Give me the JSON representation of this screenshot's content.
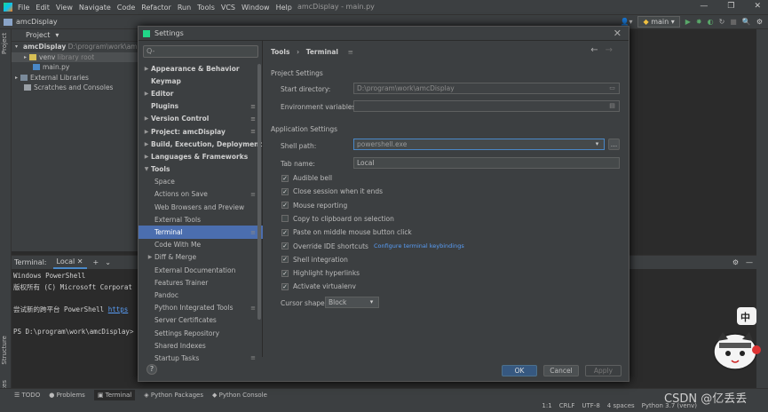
{
  "menubar": {
    "items": [
      "File",
      "Edit",
      "View",
      "Navigate",
      "Code",
      "Refactor",
      "Run",
      "Tools",
      "VCS",
      "Window",
      "Help"
    ],
    "window_title": "amcDisplay - main.py"
  },
  "navbar": {
    "project": "amcDisplay",
    "run_config": "main"
  },
  "project_panel": {
    "title": "Project",
    "tree": [
      {
        "name": "amcDisplay",
        "hint": "D:\\program\\work\\amcD"
      },
      {
        "name": "venv",
        "hint": "library root"
      },
      {
        "name": "main.py",
        "hint": ""
      },
      {
        "name": "External Libraries",
        "hint": ""
      },
      {
        "name": "Scratches and Consoles",
        "hint": ""
      }
    ]
  },
  "side_tabs": {
    "project": "Project",
    "structure": "Structure",
    "favorites": "Favorites"
  },
  "terminal": {
    "label": "Terminal:",
    "tab": "Local",
    "lines": [
      "Windows PowerShell",
      "版权所有 (C) Microsoft Corporat",
      "",
      "尝试新的跨平台 PowerShell",
      "",
      "PS D:\\program\\work\\amcDisplay> "
    ],
    "link": "https"
  },
  "bottom_tabs": [
    "TODO",
    "Problems",
    "Terminal",
    "Python Packages",
    "Python Console"
  ],
  "status_bar": {
    "pos": "1:1",
    "eol": "CRLF",
    "enc": "UTF-8",
    "indent": "4 spaces",
    "interp": "Python 3.7 (venv)"
  },
  "dialog": {
    "title": "Settings",
    "search_placeholder": "Q-",
    "nav": [
      {
        "label": "Appearance & Behavior",
        "level": 0,
        "bold": true,
        "arrow": "right",
        "gear": false
      },
      {
        "label": "Keymap",
        "level": 0,
        "bold": true,
        "arrow": "",
        "gear": false
      },
      {
        "label": "Editor",
        "level": 0,
        "bold": true,
        "arrow": "right",
        "gear": false
      },
      {
        "label": "Plugins",
        "level": 0,
        "bold": true,
        "arrow": "",
        "gear": true
      },
      {
        "label": "Version Control",
        "level": 0,
        "bold": true,
        "arrow": "right",
        "gear": true
      },
      {
        "label": "Project: amcDisplay",
        "level": 0,
        "bold": true,
        "arrow": "right",
        "gear": true
      },
      {
        "label": "Build, Execution, Deployment",
        "level": 0,
        "bold": true,
        "arrow": "right",
        "gear": false
      },
      {
        "label": "Languages & Frameworks",
        "level": 0,
        "bold": true,
        "arrow": "right",
        "gear": false
      },
      {
        "label": "Tools",
        "level": 0,
        "bold": true,
        "arrow": "down",
        "gear": false
      },
      {
        "label": "Space",
        "level": 1,
        "bold": false,
        "arrow": "",
        "gear": false
      },
      {
        "label": "Actions on Save",
        "level": 1,
        "bold": false,
        "arrow": "",
        "gear": true
      },
      {
        "label": "Web Browsers and Preview",
        "level": 1,
        "bold": false,
        "arrow": "",
        "gear": false
      },
      {
        "label": "External Tools",
        "level": 1,
        "bold": false,
        "arrow": "",
        "gear": false
      },
      {
        "label": "Terminal",
        "level": 1,
        "bold": false,
        "arrow": "",
        "gear": true,
        "selected": true
      },
      {
        "label": "Code With Me",
        "level": 1,
        "bold": false,
        "arrow": "",
        "gear": false
      },
      {
        "label": "Diff & Merge",
        "level": 1,
        "bold": false,
        "arrow": "right",
        "gear": false
      },
      {
        "label": "External Documentation",
        "level": 1,
        "bold": false,
        "arrow": "",
        "gear": false
      },
      {
        "label": "Features Trainer",
        "level": 1,
        "bold": false,
        "arrow": "",
        "gear": false
      },
      {
        "label": "Pandoc",
        "level": 1,
        "bold": false,
        "arrow": "",
        "gear": false
      },
      {
        "label": "Python Integrated Tools",
        "level": 1,
        "bold": false,
        "arrow": "",
        "gear": true
      },
      {
        "label": "Server Certificates",
        "level": 1,
        "bold": false,
        "arrow": "",
        "gear": false
      },
      {
        "label": "Settings Repository",
        "level": 1,
        "bold": false,
        "arrow": "",
        "gear": false
      },
      {
        "label": "Shared Indexes",
        "level": 1,
        "bold": false,
        "arrow": "",
        "gear": false
      },
      {
        "label": "Startup Tasks",
        "level": 1,
        "bold": false,
        "arrow": "",
        "gear": true
      }
    ],
    "breadcrumb": {
      "parent": "Tools",
      "sep": "›",
      "current": "Terminal"
    },
    "project_settings": {
      "heading": "Project Settings",
      "start_dir_label": "Start directory:",
      "start_dir_value": "D:\\program\\work\\amcDisplay",
      "env_label": "Environment variables:",
      "env_value": ""
    },
    "app_settings": {
      "heading": "Application Settings",
      "shell_label": "Shell path:",
      "shell_value": "powershell.exe",
      "tab_label": "Tab name:",
      "tab_value": "Local",
      "checkboxes": [
        {
          "label": "Audible bell",
          "checked": true
        },
        {
          "label": "Close session when it ends",
          "checked": true
        },
        {
          "label": "Mouse reporting",
          "checked": true
        },
        {
          "label": "Copy to clipboard on selection",
          "checked": false
        },
        {
          "label": "Paste on middle mouse button click",
          "checked": true
        },
        {
          "label": "Override IDE shortcuts",
          "checked": true,
          "link": "Configure terminal keybindings"
        },
        {
          "label": "Shell integration",
          "checked": true
        },
        {
          "label": "Highlight hyperlinks",
          "checked": true
        },
        {
          "label": "Activate virtualenv",
          "checked": true
        }
      ],
      "cursor_label": "Cursor shape:",
      "cursor_value": "Block"
    },
    "buttons": {
      "ok": "OK",
      "cancel": "Cancel",
      "apply": "Apply",
      "help": "?"
    }
  },
  "watermark": "CSDN @亿丢丢",
  "mascot_text": "中"
}
